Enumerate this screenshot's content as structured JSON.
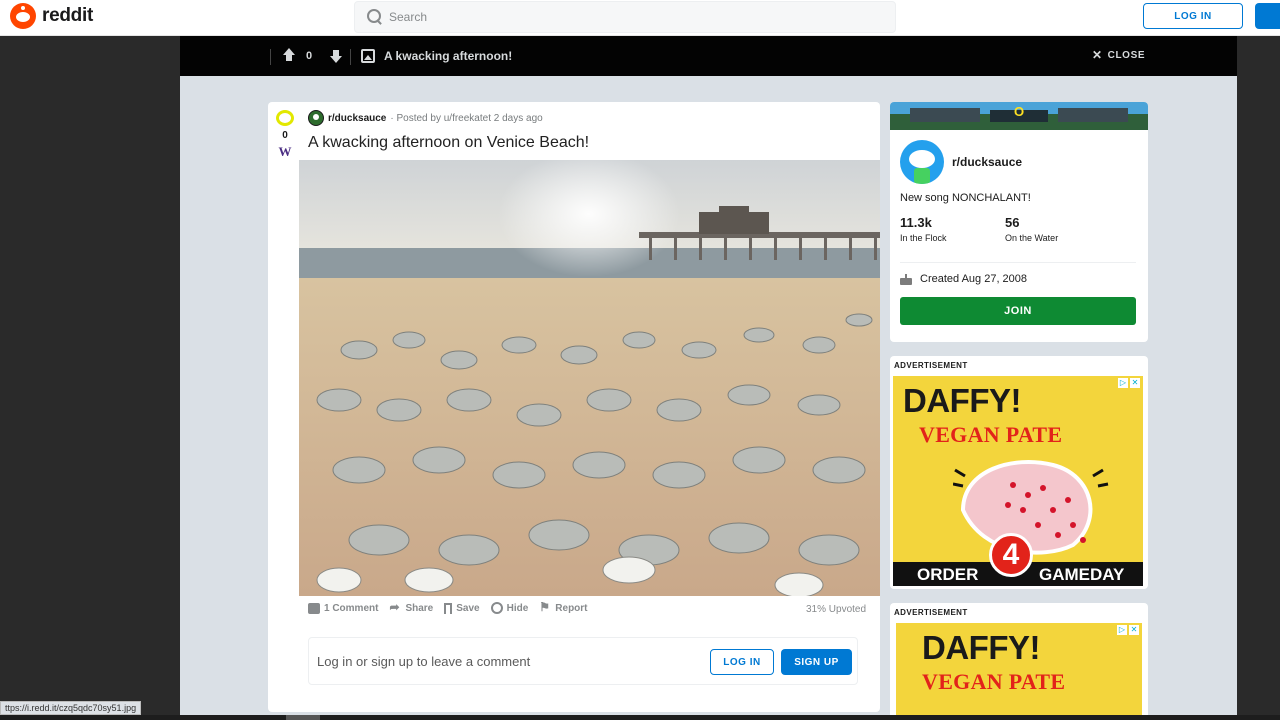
{
  "header": {
    "logo_text": "reddit",
    "search_placeholder": "Search",
    "login_label": "LOG IN"
  },
  "overlay": {
    "score": "0",
    "title": "A kwacking afternoon!",
    "close_label": "CLOSE"
  },
  "post": {
    "score": "0",
    "vote_down_glyph": "W",
    "subreddit": "r/ducksauce",
    "posted_by": "· Posted by u/freekatet 2 days ago",
    "title": "A kwacking afternoon on Venice Beach!",
    "actions": {
      "comments": "1 Comment",
      "share": "Share",
      "save": "Save",
      "hide": "Hide",
      "report": "Report"
    },
    "upvoted": "31% Upvoted",
    "comment_prompt": "Log in or sign up to leave a comment",
    "login_label": "LOG IN",
    "signup_label": "SIGN UP"
  },
  "sidebar": {
    "subreddit": "r/ducksauce",
    "description": "New song NONCHALANT!",
    "members_count": "11.3k",
    "members_label": "In the Flock",
    "online_count": "56",
    "online_label": "On the Water",
    "created": "Created Aug 27, 2008",
    "join_label": "JOIN",
    "banner_letter": "O"
  },
  "ads": [
    {
      "label": "ADVERTISEMENT",
      "headline": "DAFFY!",
      "subheadline": "VEGAN PATE",
      "bottom_left": "ORDER",
      "bottom_right": "GAMEDAY",
      "badge": "4"
    },
    {
      "label": "ADVERTISEMENT",
      "headline": "DAFFY!",
      "subheadline": "VEGAN PATE"
    }
  ],
  "statusbar": {
    "url": "ttps://i.redd.it/czq5qdc70sy51.jpg"
  },
  "colors": {
    "brand": "#ff4500",
    "primary_blue": "#0079d3",
    "join_green": "#0e8a33",
    "ad_yellow": "#f3d53c",
    "ad_red": "#e2231a"
  }
}
